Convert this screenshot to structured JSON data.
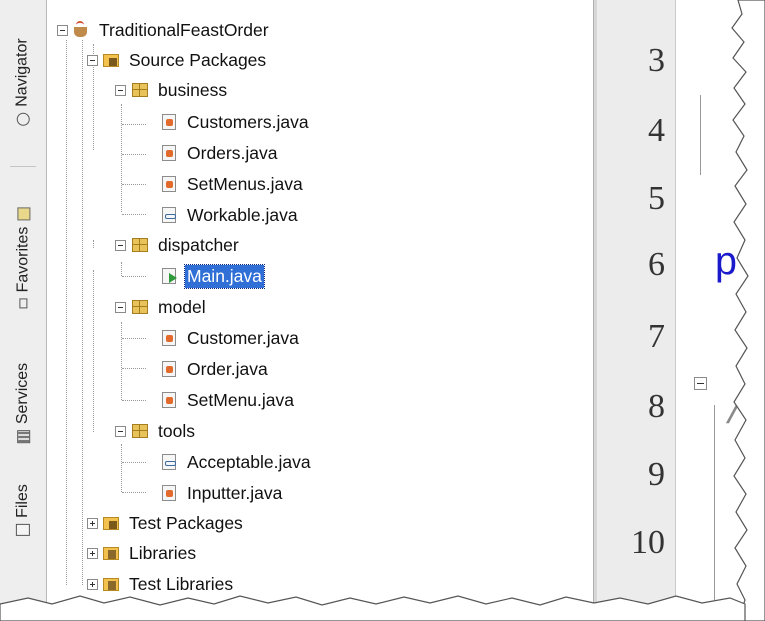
{
  "side_tabs": [
    {
      "label": "Navigator",
      "icon": "navigator-icon"
    },
    {
      "label": "Favorites",
      "icon": "favorites-icon"
    },
    {
      "label": "Services",
      "icon": "services-icon"
    },
    {
      "label": "Files",
      "icon": "files-icon"
    }
  ],
  "tree": {
    "project": "TraditionalFeastOrder",
    "source_packages": "Source Packages",
    "packages": [
      {
        "name": "business",
        "files": [
          "Customers.java",
          "Orders.java",
          "SetMenus.java",
          "Workable.java"
        ]
      },
      {
        "name": "dispatcher",
        "files": [
          "Main.java"
        ]
      },
      {
        "name": "model",
        "files": [
          "Customer.java",
          "Order.java",
          "SetMenu.java"
        ]
      },
      {
        "name": "tools",
        "files": [
          "Acceptable.java",
          "Inputter.java"
        ]
      }
    ],
    "selected_file": "Main.java",
    "test_packages": "Test Packages",
    "libraries": "Libraries",
    "test_libraries": "Test Libraries"
  },
  "editor": {
    "line_numbers": [
      "3",
      "4",
      "5",
      "6",
      "7",
      "8",
      "9",
      "10"
    ],
    "code_fragments": {
      "line6": "p",
      "line8": "/"
    },
    "colors": {
      "keyword": "#1a1acc",
      "comment": "#8a8a8a",
      "selection": "#2f6fd6"
    }
  }
}
